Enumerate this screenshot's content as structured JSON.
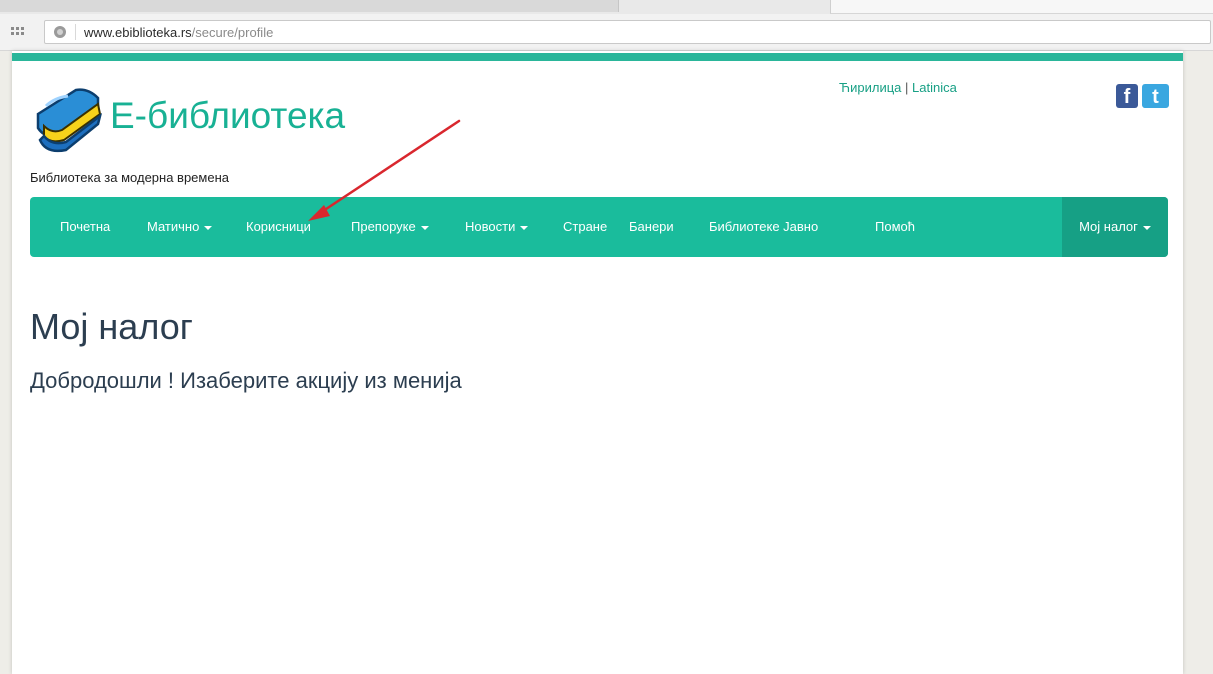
{
  "browser": {
    "url_domain": "www.ebiblioteka.rs",
    "url_path": "/secure/profile"
  },
  "header": {
    "title": "Е-библиотека",
    "tagline": "Библиотека за модерна времена",
    "lang_cyrillic": "Ћирилица",
    "lang_separator": "|",
    "lang_latin": "Latinica",
    "social_facebook": "f",
    "social_twitter": "t"
  },
  "nav": {
    "items": [
      {
        "label": "Почетна"
      },
      {
        "label": "Матично"
      },
      {
        "label": "Корисници"
      },
      {
        "label": "Препоруке"
      },
      {
        "label": "Новости"
      },
      {
        "label": "Стране"
      },
      {
        "label": "Банери"
      },
      {
        "label": "Библиотеке Јавно"
      },
      {
        "label": "Помоћ"
      }
    ],
    "account": "Мој налог"
  },
  "main": {
    "heading": "Мој налог",
    "welcome": "Добродошли ! Изаберите акцију из менија"
  },
  "colors": {
    "accent": "#1abc9c",
    "accent_dark": "#16a085",
    "annotation_arrow": "#d9272e"
  },
  "icons": [
    "apps-icon",
    "globe-icon",
    "book-logo-icon",
    "facebook-icon",
    "twitter-icon",
    "caret-down-icon"
  ]
}
